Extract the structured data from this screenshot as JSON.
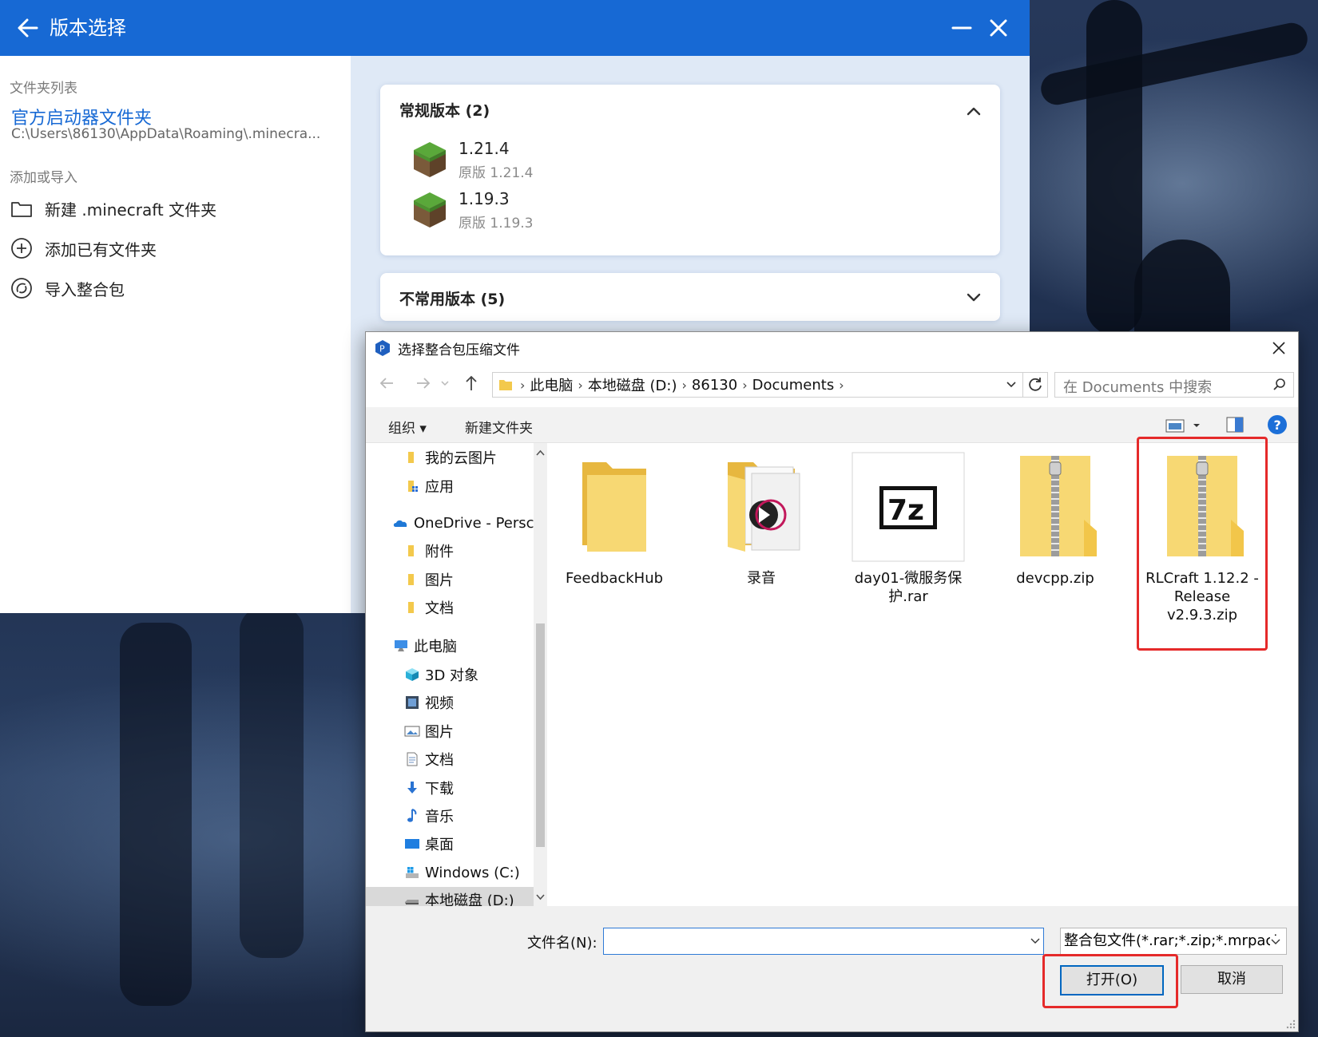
{
  "launcher": {
    "title": "版本选择",
    "sidebar": {
      "folder_list_label": "文件夹列表",
      "folder_name": "官方启动器文件夹",
      "folder_path": "C:\\Users\\86130\\AppData\\Roaming\\.minecra...",
      "add_import_label": "添加或导入",
      "items": [
        {
          "label": "新建 .minecraft 文件夹",
          "icon": "folder-icon"
        },
        {
          "label": "添加已有文件夹",
          "icon": "plus-circle-icon"
        },
        {
          "label": "导入整合包",
          "icon": "modpack-icon"
        }
      ]
    },
    "groups": [
      {
        "title": "常规版本 (2)",
        "expanded": true,
        "versions": [
          {
            "name": "1.21.4",
            "desc": "原版 1.21.4"
          },
          {
            "name": "1.19.3",
            "desc": "原版 1.19.3"
          }
        ]
      },
      {
        "title": "不常用版本 (5)",
        "expanded": false,
        "versions": []
      }
    ]
  },
  "dialog": {
    "title": "选择整合包压缩文件",
    "breadcrumb": [
      "此电脑",
      "本地磁盘 (D:)",
      "86130",
      "Documents"
    ],
    "search_placeholder": "在 Documents 中搜索",
    "toolbar": {
      "organize": "组织",
      "new_folder": "新建文件夹"
    },
    "nav_tree": [
      {
        "label": "我的云图片",
        "icon": "folder-icon",
        "indent": 1
      },
      {
        "label": "应用",
        "icon": "folder-apps-icon",
        "indent": 1
      },
      {
        "label": "OneDrive - Persc",
        "icon": "onedrive-cloud-icon",
        "indent": 0
      },
      {
        "label": "附件",
        "icon": "folder-icon",
        "indent": 1
      },
      {
        "label": "图片",
        "icon": "folder-icon",
        "indent": 1
      },
      {
        "label": "文档",
        "icon": "folder-icon",
        "indent": 1
      },
      {
        "label": "此电脑",
        "icon": "computer-icon",
        "indent": 0
      },
      {
        "label": "3D 对象",
        "icon": "cube-3d-icon",
        "indent": 1
      },
      {
        "label": "视频",
        "icon": "video-film-icon",
        "indent": 1
      },
      {
        "label": "图片",
        "icon": "picture-icon",
        "indent": 1
      },
      {
        "label": "文档",
        "icon": "document-icon",
        "indent": 1
      },
      {
        "label": "下载",
        "icon": "download-arrow-icon",
        "indent": 1
      },
      {
        "label": "音乐",
        "icon": "music-note-icon",
        "indent": 1
      },
      {
        "label": "桌面",
        "icon": "desktop-icon",
        "indent": 1
      },
      {
        "label": "Windows (C:)",
        "icon": "windows-drive-icon",
        "indent": 1
      },
      {
        "label": "本地磁盘 (D:)",
        "icon": "drive-icon",
        "indent": 1,
        "selected": true
      }
    ],
    "files": [
      {
        "name": "FeedbackHub",
        "icon": "folder-icon"
      },
      {
        "name": "录音",
        "icon": "media-folder-icon"
      },
      {
        "name": "day01-微服务保护.rar",
        "icon": "7z-archive-icon"
      },
      {
        "name": "devcpp.zip",
        "icon": "zip-folder-icon"
      },
      {
        "name": "RLCraft 1.12.2 - Release v2.9.3.zip",
        "icon": "zip-folder-icon",
        "highlighted": true
      }
    ],
    "filename_label": "文件名(N):",
    "filename_value": "",
    "filter_text": "整合包文件(*.rar;*.zip;*.mrpacl",
    "open_button": "打开(O)",
    "cancel_button": "取消"
  },
  "colors": {
    "accent": "#1769d4",
    "highlight": "#e52a2a"
  }
}
